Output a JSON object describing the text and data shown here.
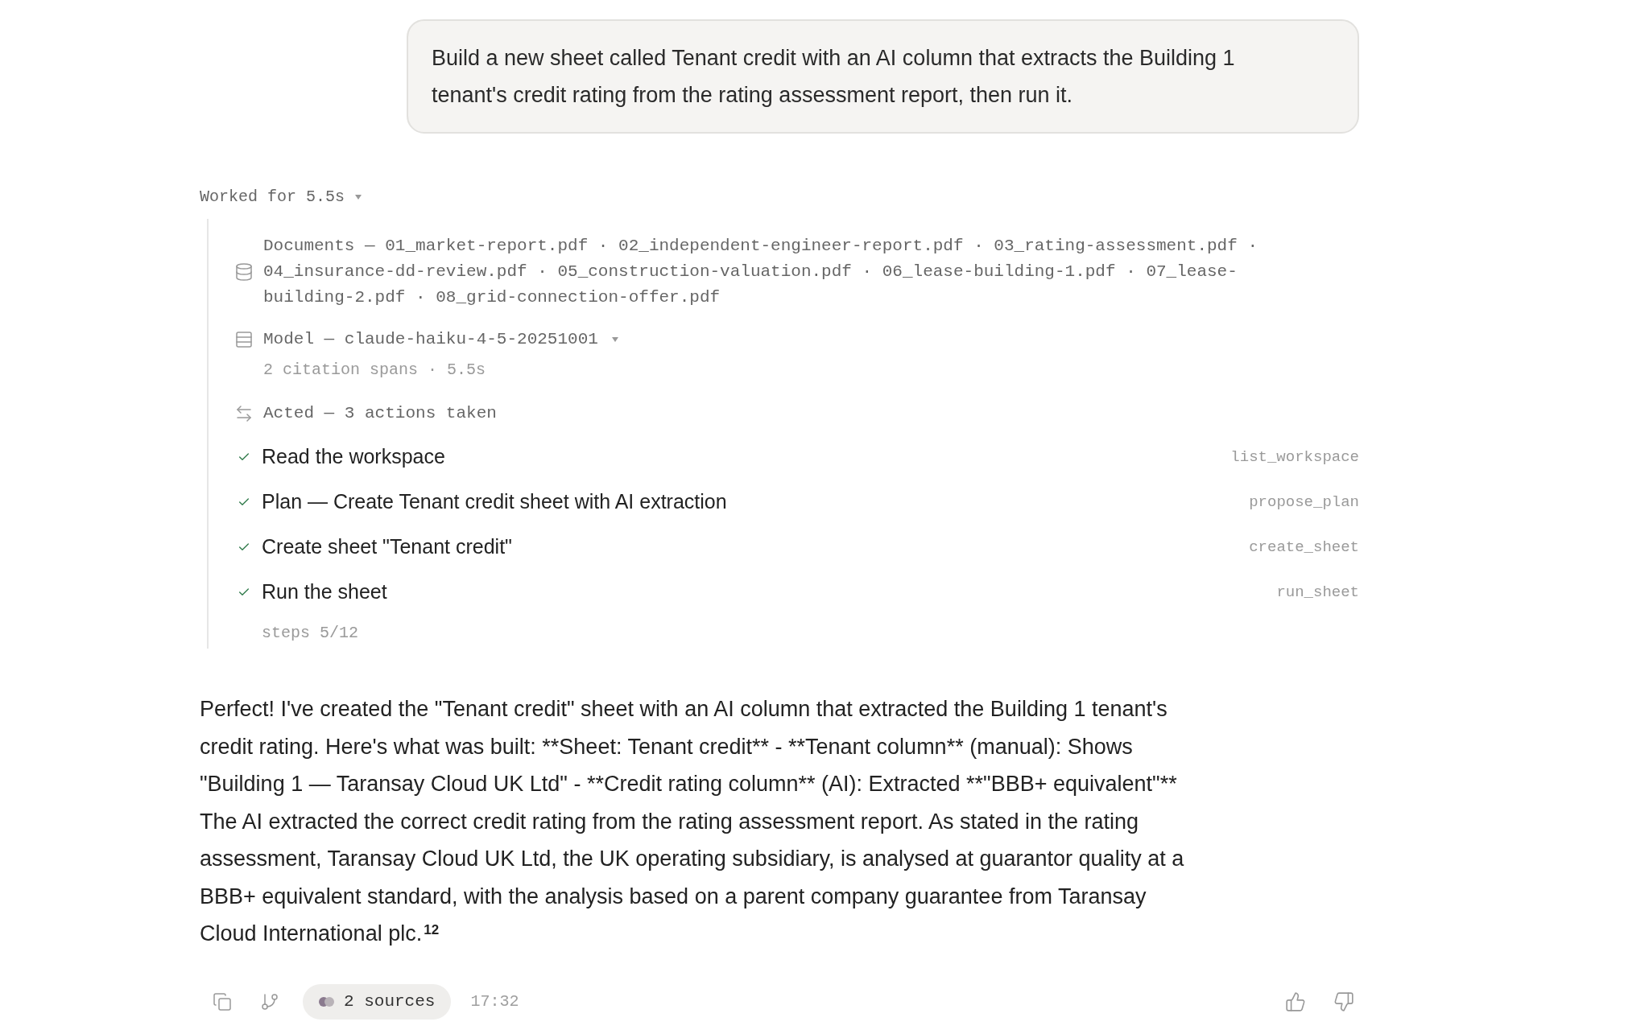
{
  "user_message": "Build a new sheet called Tenant credit with an AI column that extracts the Building 1 tenant's credit rating from the rating assessment report, then run it.",
  "work": {
    "summary": "Worked for 5.5s",
    "expanded": true,
    "documents": {
      "label": "Documents — 01_market-report.pdf · 02_independent-engineer-report.pdf · 03_rating-assessment.pdf · 04_insurance-dd-review.pdf · 05_construction-valuation.pdf · 06_lease-building-1.pdf · 07_lease-building-2.pdf · 08_grid-connection-offer.pdf"
    },
    "model": {
      "label": "Model — claude-haiku-4-5-20251001",
      "detail": "2 citation spans · 5.5s"
    },
    "acted": {
      "label": "Acted — 3 actions taken"
    },
    "steps": [
      {
        "label": "Read the workspace",
        "tool": "list_workspace",
        "done": true
      },
      {
        "label": "Plan — Create Tenant credit sheet with AI extraction",
        "tool": "propose_plan",
        "done": true
      },
      {
        "label": "Create sheet \"Tenant credit\"",
        "tool": "create_sheet",
        "done": true
      },
      {
        "label": "Run the sheet",
        "tool": "run_sheet",
        "done": true
      }
    ],
    "progress": "steps 5/12"
  },
  "answer": {
    "text": "Perfect! I've created the \"Tenant credit\" sheet with an AI column that extracted the Building 1 tenant's credit rating. Here's what was built: **Sheet: Tenant credit** - **Tenant column** (manual): Shows \"Building 1 — Taransay Cloud UK Ltd\" - **Credit rating column** (AI): Extracted **\"BBB+ equivalent\"** The AI extracted the correct credit rating from the rating assessment report. As stated in the rating assessment, Taransay Cloud UK Ltd, the UK operating subsidiary, is analysed at guarantor quality at a BBB+ equivalent standard, with the analysis based on a parent company guarantee from Taransay Cloud International plc.",
    "citations": [
      "1",
      "2"
    ]
  },
  "footer": {
    "sources": "2 sources",
    "time": "17:32"
  }
}
